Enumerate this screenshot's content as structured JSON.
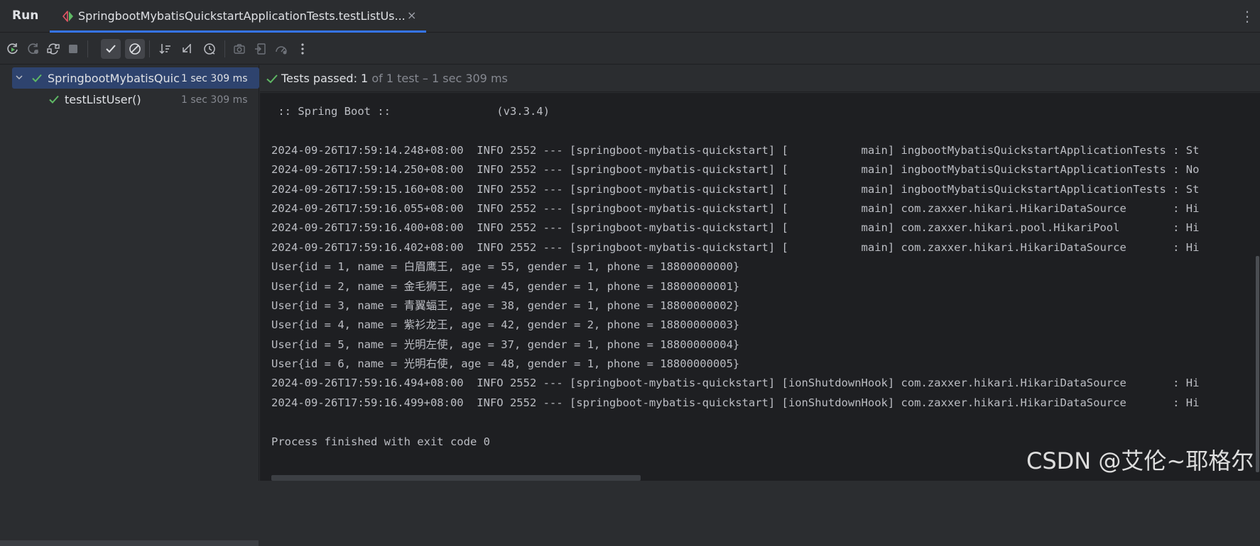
{
  "tabbar": {
    "run_label": "Run",
    "tab_title": "SpringbootMybatisQuickstartApplicationTests.testListUs...",
    "tab_close": "×",
    "more": "⋮"
  },
  "toolbar": {
    "icons": [
      "rerun-icon",
      "rerun-failed-icon",
      "toggle-auto-test-icon",
      "stop-icon",
      "show-passed-icon",
      "show-ignored-icon",
      "sort-icon",
      "collapse-icon",
      "history-icon",
      "screenshot-icon",
      "import-icon",
      "coverage-icon",
      "more-icon"
    ]
  },
  "tree": {
    "root": {
      "label": "SpringbootMybatisQuickstartApplicationTests",
      "time": "1 sec 309 ms"
    },
    "child": {
      "label": "testListUser()",
      "time": "1 sec 309 ms"
    }
  },
  "status": {
    "passed_label": "Tests passed: ",
    "passed_count": "1",
    "rest": " of 1 test – 1 sec 309 ms"
  },
  "console": {
    "lines": [
      " :: Spring Boot ::                (v3.3.4)",
      "",
      "2024-09-26T17:59:14.248+08:00  INFO 2552 --- [springboot-mybatis-quickstart] [           main] ingbootMybatisQuickstartApplicationTests : St",
      "2024-09-26T17:59:14.250+08:00  INFO 2552 --- [springboot-mybatis-quickstart] [           main] ingbootMybatisQuickstartApplicationTests : No",
      "2024-09-26T17:59:15.160+08:00  INFO 2552 --- [springboot-mybatis-quickstart] [           main] ingbootMybatisQuickstartApplicationTests : St",
      "2024-09-26T17:59:16.055+08:00  INFO 2552 --- [springboot-mybatis-quickstart] [           main] com.zaxxer.hikari.HikariDataSource       : Hi",
      "2024-09-26T17:59:16.400+08:00  INFO 2552 --- [springboot-mybatis-quickstart] [           main] com.zaxxer.hikari.pool.HikariPool        : Hi",
      "2024-09-26T17:59:16.402+08:00  INFO 2552 --- [springboot-mybatis-quickstart] [           main] com.zaxxer.hikari.HikariDataSource       : Hi",
      "User{id = 1, name = 白眉鹰王, age = 55, gender = 1, phone = 18800000000}",
      "User{id = 2, name = 金毛狮王, age = 45, gender = 1, phone = 18800000001}",
      "User{id = 3, name = 青翼蝠王, age = 38, gender = 1, phone = 18800000002}",
      "User{id = 4, name = 紫衫龙王, age = 42, gender = 2, phone = 18800000003}",
      "User{id = 5, name = 光明左使, age = 37, gender = 1, phone = 18800000004}",
      "User{id = 6, name = 光明右使, age = 48, gender = 1, phone = 18800000005}",
      "2024-09-26T17:59:16.494+08:00  INFO 2552 --- [springboot-mybatis-quickstart] [ionShutdownHook] com.zaxxer.hikari.HikariDataSource       : Hi",
      "2024-09-26T17:59:16.499+08:00  INFO 2552 --- [springboot-mybatis-quickstart] [ionShutdownHook] com.zaxxer.hikari.HikariDataSource       : Hi",
      "",
      "Process finished with exit code 0"
    ]
  },
  "watermark": "CSDN @艾伦~耶格尔",
  "colors": {
    "accent": "#3574f0",
    "success": "#5fb865",
    "selection": "#2e436e"
  }
}
